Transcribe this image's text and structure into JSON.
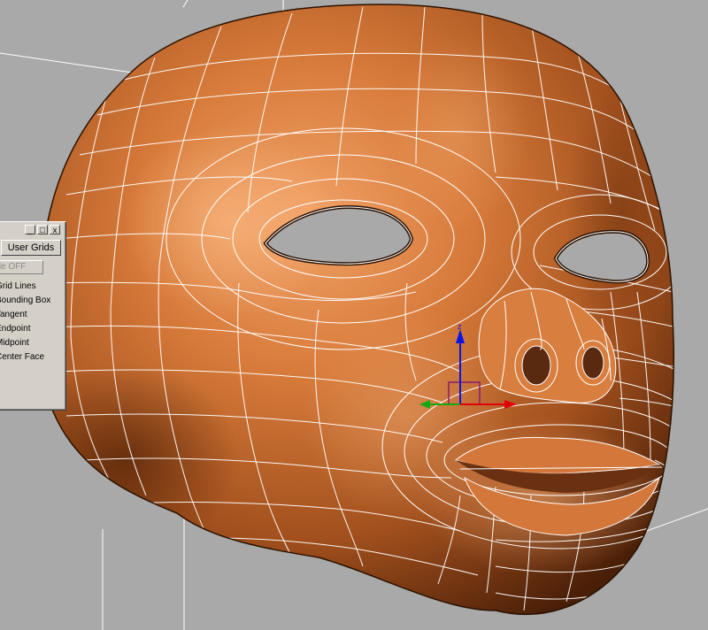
{
  "viewport": {
    "background_color": "#a9a9a9",
    "grid_line_color": "#ffffff",
    "mesh_color": "#c96a2e",
    "wire_color": "#ffffff"
  },
  "gizmo": {
    "x_axis_color": "#e0000a",
    "y_axis_color": "#13a913",
    "z_axis_color": "#0a14e6",
    "plane_color": "#8a1a6e"
  },
  "snaps_panel": {
    "window_buttons": [
      "_",
      "□",
      "x"
    ],
    "tabs": [
      "",
      "User Grids"
    ],
    "override_label": "rride OFF",
    "options": [
      "Grid Lines",
      "Bounding Box",
      "Tangent",
      "Endpoint",
      "Midpoint",
      "Center Face"
    ]
  }
}
